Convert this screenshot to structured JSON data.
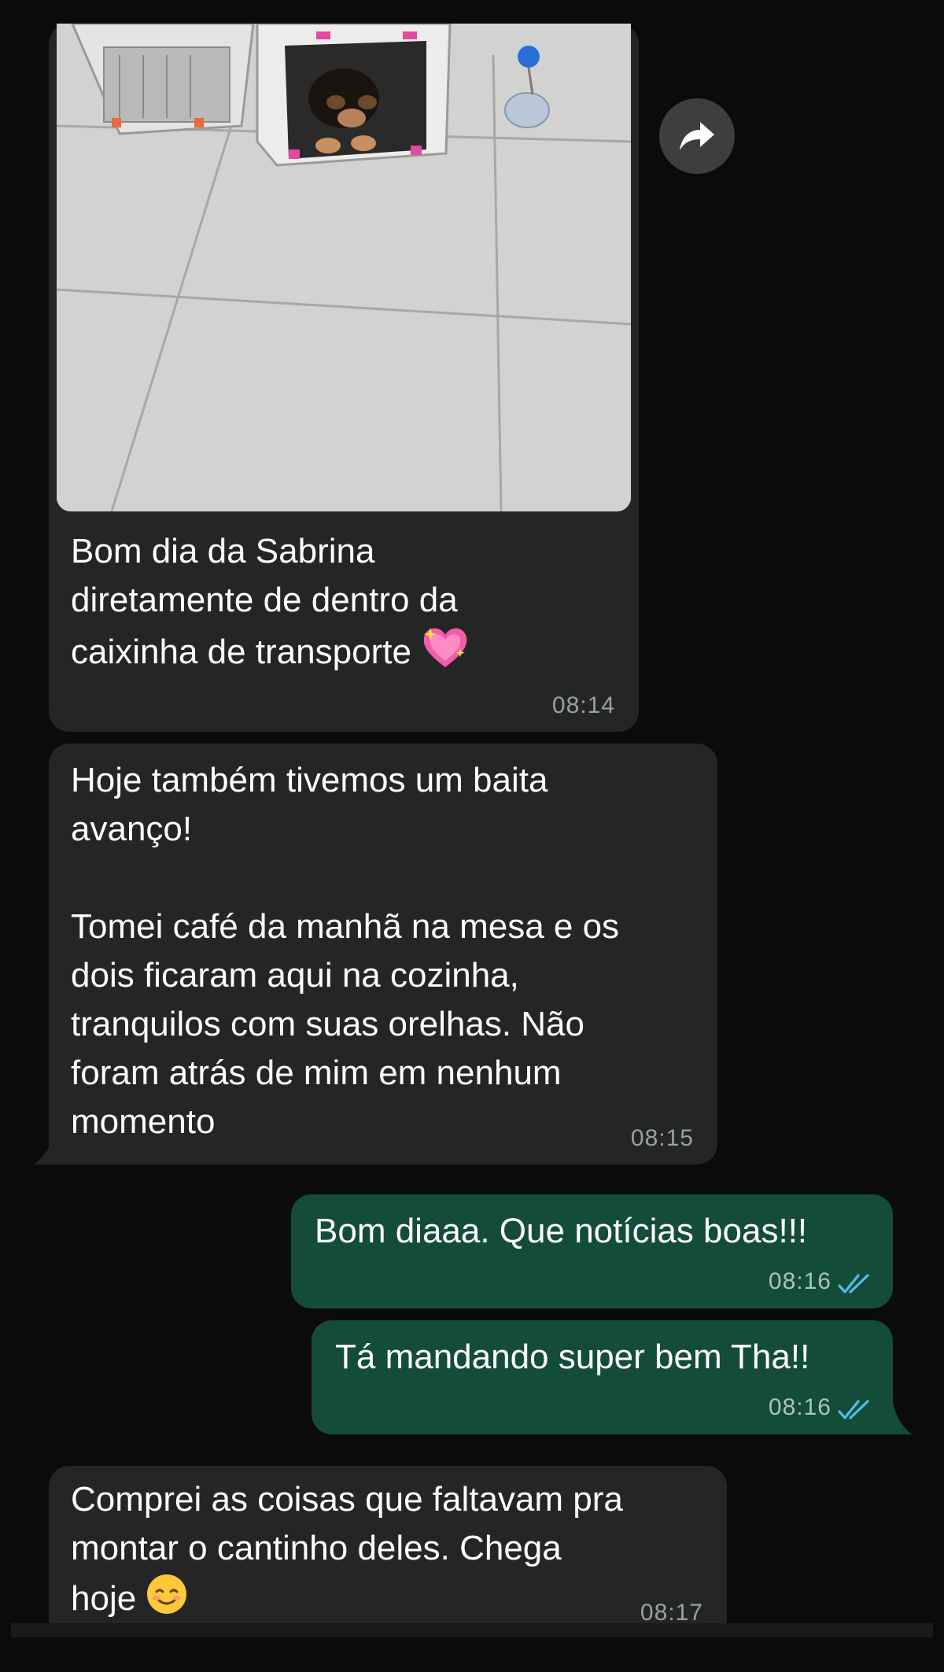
{
  "messages": [
    {
      "direction": "incoming",
      "has_photo": true,
      "text": "Bom dia da Sabrina\ndiretamente de dentro da\ncaixinha de transporte",
      "emoji": "sparkling-heart",
      "time": "08:14"
    },
    {
      "direction": "incoming",
      "text": "Hoje também tivemos um baita\navanço!\n\nTomei café da manhã na mesa e os\ndois ficaram aqui na cozinha,\ntranquilos com suas orelhas. Não\nforam atrás de mim em nenhum\nmomento",
      "time": "08:15"
    },
    {
      "direction": "outgoing",
      "text": "Bom diaaa. Que notícias boas!!!",
      "time": "08:16",
      "status": "read"
    },
    {
      "direction": "outgoing",
      "text": "Tá mandando super bem Tha!!",
      "time": "08:16",
      "status": "read"
    },
    {
      "direction": "incoming",
      "text": "Comprei as coisas que faltavam pra\nmontar o cantinho deles. Chega\nhoje",
      "emoji": "smiling-face",
      "time": "08:17"
    }
  ],
  "colors": {
    "background": "#0b0b0b",
    "incoming_bubble": "#242626",
    "outgoing_bubble": "#144d37",
    "read_ticks": "#53bdeb"
  }
}
